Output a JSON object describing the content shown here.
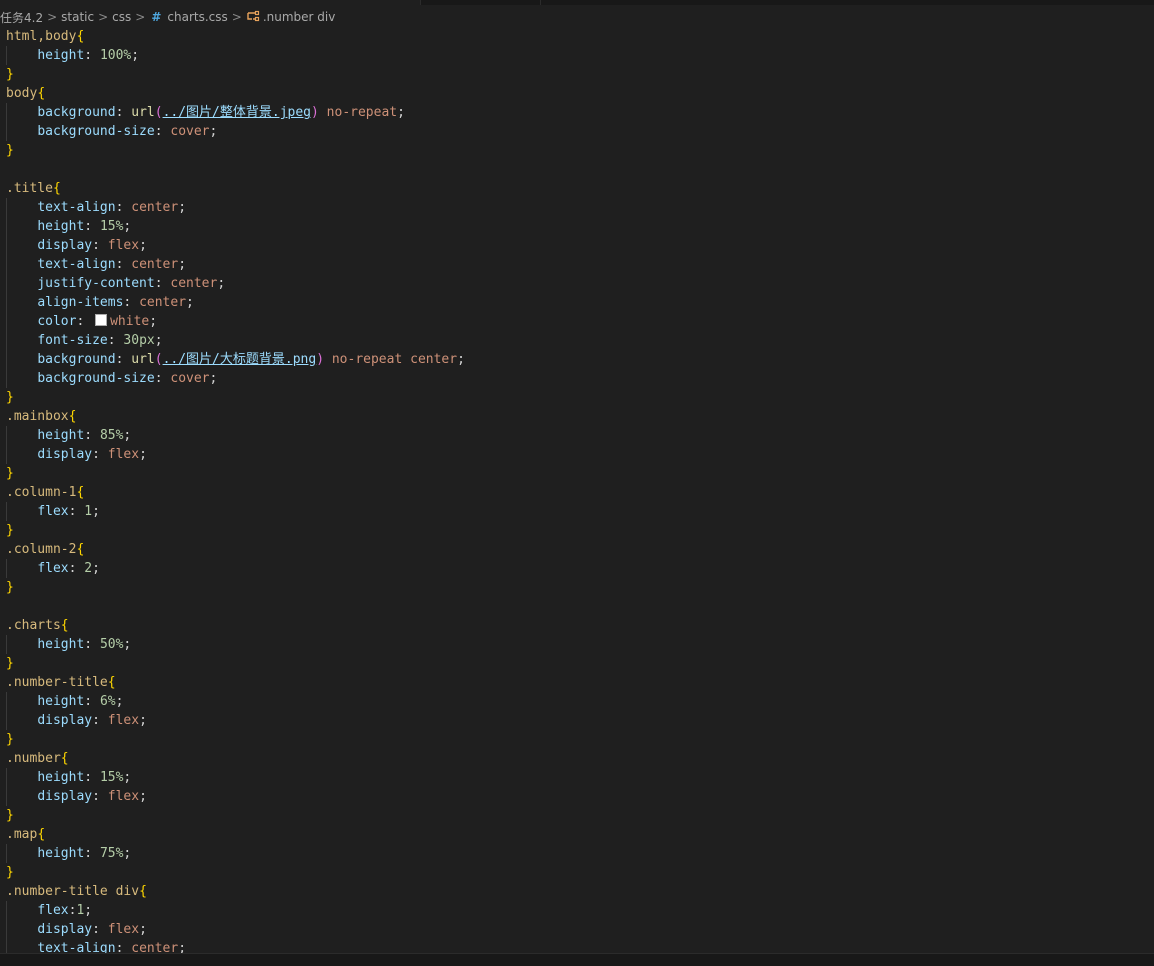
{
  "breadcrumb": {
    "items": [
      "任务4.2",
      "static",
      "css",
      "charts.css",
      ".number div"
    ],
    "separator": ">"
  },
  "code": {
    "lines": [
      [
        [
          "sel",
          "html,body"
        ],
        [
          "brace",
          "{"
        ]
      ],
      [
        [
          "txt",
          "    "
        ],
        [
          "prop",
          "height"
        ],
        [
          "txt",
          ": "
        ],
        [
          "num",
          "100%"
        ],
        [
          "txt",
          ";"
        ]
      ],
      [
        [
          "brace",
          "}"
        ]
      ],
      [
        [
          "sel",
          "body"
        ],
        [
          "brace",
          "{"
        ]
      ],
      [
        [
          "txt",
          "    "
        ],
        [
          "prop",
          "background"
        ],
        [
          "txt",
          ": "
        ],
        [
          "fn",
          "url"
        ],
        [
          "paren",
          "("
        ],
        [
          "url",
          "../图片/整体背景.jpeg"
        ],
        [
          "paren",
          ")"
        ],
        [
          "txt",
          " "
        ],
        [
          "kw",
          "no-repeat"
        ],
        [
          "txt",
          ";"
        ]
      ],
      [
        [
          "txt",
          "    "
        ],
        [
          "prop",
          "background-size"
        ],
        [
          "txt",
          ": "
        ],
        [
          "kw",
          "cover"
        ],
        [
          "txt",
          ";"
        ]
      ],
      [
        [
          "brace",
          "}"
        ]
      ],
      [],
      [
        [
          "sel",
          ".title"
        ],
        [
          "brace",
          "{"
        ]
      ],
      [
        [
          "txt",
          "    "
        ],
        [
          "prop",
          "text-align"
        ],
        [
          "txt",
          ": "
        ],
        [
          "kw",
          "center"
        ],
        [
          "txt",
          ";"
        ]
      ],
      [
        [
          "txt",
          "    "
        ],
        [
          "prop",
          "height"
        ],
        [
          "txt",
          ": "
        ],
        [
          "num",
          "15%"
        ],
        [
          "txt",
          ";"
        ]
      ],
      [
        [
          "txt",
          "    "
        ],
        [
          "prop",
          "display"
        ],
        [
          "txt",
          ": "
        ],
        [
          "kw",
          "flex"
        ],
        [
          "txt",
          ";"
        ]
      ],
      [
        [
          "txt",
          "    "
        ],
        [
          "prop",
          "text-align"
        ],
        [
          "txt",
          ": "
        ],
        [
          "kw",
          "center"
        ],
        [
          "txt",
          ";"
        ]
      ],
      [
        [
          "txt",
          "    "
        ],
        [
          "prop",
          "justify-content"
        ],
        [
          "txt",
          ": "
        ],
        [
          "kw",
          "center"
        ],
        [
          "txt",
          ";"
        ]
      ],
      [
        [
          "txt",
          "    "
        ],
        [
          "prop",
          "align-items"
        ],
        [
          "txt",
          ": "
        ],
        [
          "kw",
          "center"
        ],
        [
          "txt",
          ";"
        ]
      ],
      [
        [
          "txt",
          "    "
        ],
        [
          "prop",
          "color"
        ],
        [
          "txt",
          ": "
        ],
        [
          "swatch",
          ""
        ],
        [
          "kw",
          "white"
        ],
        [
          "txt",
          ";"
        ]
      ],
      [
        [
          "txt",
          "    "
        ],
        [
          "prop",
          "font-size"
        ],
        [
          "txt",
          ": "
        ],
        [
          "num",
          "30px"
        ],
        [
          "txt",
          ";"
        ]
      ],
      [
        [
          "txt",
          "    "
        ],
        [
          "prop",
          "background"
        ],
        [
          "txt",
          ": "
        ],
        [
          "fn",
          "url"
        ],
        [
          "paren",
          "("
        ],
        [
          "url",
          "../图片/大标题背景.png"
        ],
        [
          "paren",
          ")"
        ],
        [
          "txt",
          " "
        ],
        [
          "kw",
          "no-repeat"
        ],
        [
          "txt",
          " "
        ],
        [
          "kw",
          "center"
        ],
        [
          "txt",
          ";"
        ]
      ],
      [
        [
          "txt",
          "    "
        ],
        [
          "prop",
          "background-size"
        ],
        [
          "txt",
          ": "
        ],
        [
          "kw",
          "cover"
        ],
        [
          "txt",
          ";"
        ]
      ],
      [
        [
          "brace",
          "}"
        ]
      ],
      [
        [
          "sel",
          ".mainbox"
        ],
        [
          "brace",
          "{"
        ]
      ],
      [
        [
          "txt",
          "    "
        ],
        [
          "prop",
          "height"
        ],
        [
          "txt",
          ": "
        ],
        [
          "num",
          "85%"
        ],
        [
          "txt",
          ";"
        ]
      ],
      [
        [
          "txt",
          "    "
        ],
        [
          "prop",
          "display"
        ],
        [
          "txt",
          ": "
        ],
        [
          "kw",
          "flex"
        ],
        [
          "txt",
          ";"
        ]
      ],
      [
        [
          "brace",
          "}"
        ]
      ],
      [
        [
          "sel",
          ".column-1"
        ],
        [
          "brace",
          "{"
        ]
      ],
      [
        [
          "txt",
          "    "
        ],
        [
          "prop",
          "flex"
        ],
        [
          "txt",
          ": "
        ],
        [
          "num",
          "1"
        ],
        [
          "txt",
          ";"
        ]
      ],
      [
        [
          "brace",
          "}"
        ]
      ],
      [
        [
          "sel",
          ".column-2"
        ],
        [
          "brace",
          "{"
        ]
      ],
      [
        [
          "txt",
          "    "
        ],
        [
          "prop",
          "flex"
        ],
        [
          "txt",
          ": "
        ],
        [
          "num",
          "2"
        ],
        [
          "txt",
          ";"
        ]
      ],
      [
        [
          "brace",
          "}"
        ]
      ],
      [],
      [
        [
          "sel",
          ".charts"
        ],
        [
          "brace",
          "{"
        ]
      ],
      [
        [
          "txt",
          "    "
        ],
        [
          "prop",
          "height"
        ],
        [
          "txt",
          ": "
        ],
        [
          "num",
          "50%"
        ],
        [
          "txt",
          ";"
        ]
      ],
      [
        [
          "brace",
          "}"
        ]
      ],
      [
        [
          "sel",
          ".number-title"
        ],
        [
          "brace",
          "{"
        ]
      ],
      [
        [
          "txt",
          "    "
        ],
        [
          "prop",
          "height"
        ],
        [
          "txt",
          ": "
        ],
        [
          "num",
          "6%"
        ],
        [
          "txt",
          ";"
        ]
      ],
      [
        [
          "txt",
          "    "
        ],
        [
          "prop",
          "display"
        ],
        [
          "txt",
          ": "
        ],
        [
          "kw",
          "flex"
        ],
        [
          "txt",
          ";"
        ]
      ],
      [
        [
          "brace",
          "}"
        ]
      ],
      [
        [
          "sel",
          ".number"
        ],
        [
          "brace",
          "{"
        ]
      ],
      [
        [
          "txt",
          "    "
        ],
        [
          "prop",
          "height"
        ],
        [
          "txt",
          ": "
        ],
        [
          "num",
          "15%"
        ],
        [
          "txt",
          ";"
        ]
      ],
      [
        [
          "txt",
          "    "
        ],
        [
          "prop",
          "display"
        ],
        [
          "txt",
          ": "
        ],
        [
          "kw",
          "flex"
        ],
        [
          "txt",
          ";"
        ]
      ],
      [
        [
          "brace",
          "}"
        ]
      ],
      [
        [
          "sel",
          ".map"
        ],
        [
          "brace",
          "{"
        ]
      ],
      [
        [
          "txt",
          "    "
        ],
        [
          "prop",
          "height"
        ],
        [
          "txt",
          ": "
        ],
        [
          "num",
          "75%"
        ],
        [
          "txt",
          ";"
        ]
      ],
      [
        [
          "brace",
          "}"
        ]
      ],
      [
        [
          "sel",
          ".number-title div"
        ],
        [
          "brace",
          "{"
        ]
      ],
      [
        [
          "txt",
          "    "
        ],
        [
          "prop",
          "flex"
        ],
        [
          "txt",
          ":"
        ],
        [
          "num",
          "1"
        ],
        [
          "txt",
          ";"
        ]
      ],
      [
        [
          "txt",
          "    "
        ],
        [
          "prop",
          "display"
        ],
        [
          "txt",
          ": "
        ],
        [
          "kw",
          "flex"
        ],
        [
          "txt",
          ";"
        ]
      ],
      [
        [
          "txt",
          "    "
        ],
        [
          "prop",
          "text-align"
        ],
        [
          "txt",
          ": "
        ],
        [
          "kw",
          "center"
        ],
        [
          "txt",
          ";"
        ]
      ]
    ]
  },
  "colors": {
    "background": "#1f1f1f",
    "selector": "#d7ba7d",
    "property": "#9cdcfe",
    "number": "#b5cea8",
    "keyword": "#ce9178",
    "brace": "#ffd700",
    "paren": "#da70d6",
    "function": "#dcdcaa"
  },
  "icons": [
    "chevron-right-icon",
    "hash-icon",
    "symbol-class-icon"
  ]
}
